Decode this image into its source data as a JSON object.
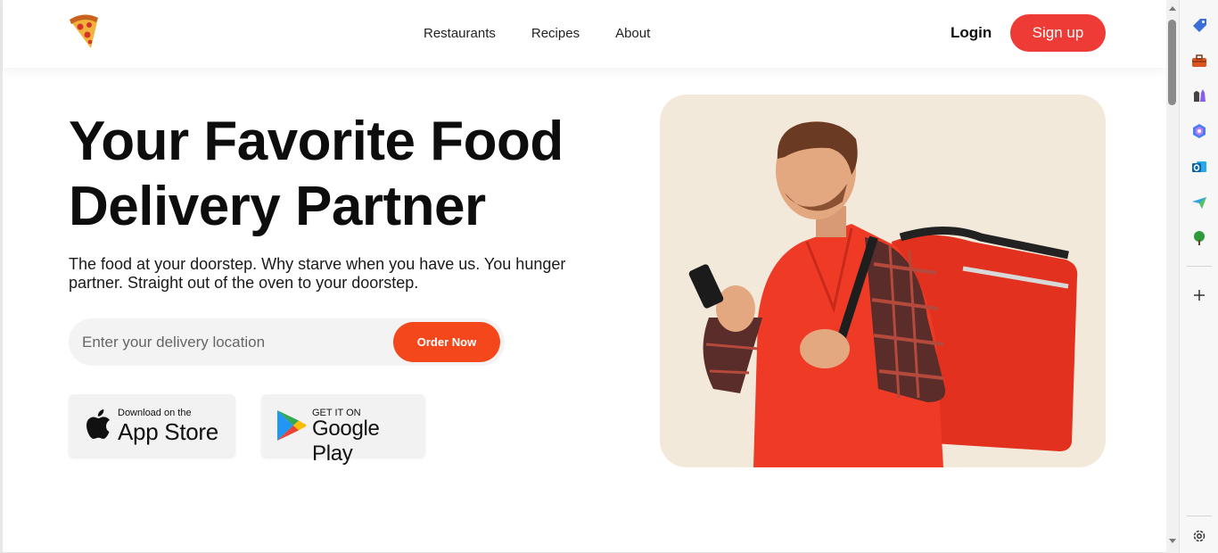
{
  "header": {
    "logo_icon": "pizza-slice-icon",
    "nav": [
      {
        "label": "Restaurants"
      },
      {
        "label": "Recipes"
      },
      {
        "label": "About"
      }
    ],
    "login_label": "Login",
    "signup_label": "Sign up"
  },
  "hero": {
    "title_line1": "Your Favorite Food",
    "title_line2": "Delivery Partner",
    "subtitle": "The food at your doorstep. Why starve when you have us. You hunger partner. Straight out of the oven to your doorstep.",
    "search": {
      "placeholder": "Enter your delivery location",
      "value": "",
      "button_label": "Order Now"
    },
    "app_store": {
      "small": "Download on the",
      "big": "App Store"
    },
    "google_play": {
      "small": "GET IT ON",
      "big": "Google Play"
    },
    "image": "delivery-man-with-phone-and-red-bag"
  },
  "sidebar": {
    "icons": [
      "tag-icon",
      "toolbox-icon",
      "chess-icon",
      "copilot-icon",
      "outlook-icon",
      "send-icon",
      "tree-icon",
      "plus-icon",
      "settings-icon"
    ]
  },
  "colors": {
    "accent_red": "#ef3b35",
    "order_orange": "#f5471c",
    "image_bg": "#f3e9da"
  }
}
